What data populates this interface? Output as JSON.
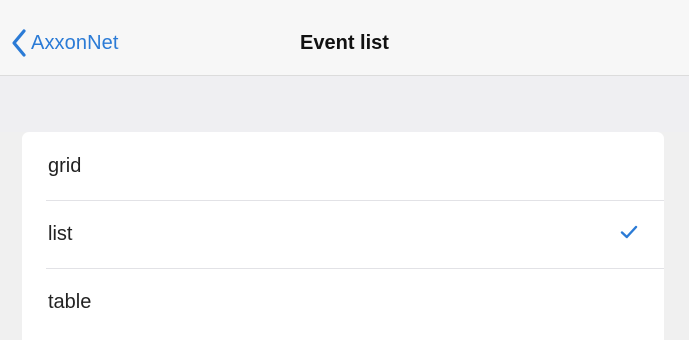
{
  "nav": {
    "back_label": "AxxonNet",
    "title": "Event list",
    "back_icon": "chevron-left-icon",
    "accent_color": "#2b7bd6"
  },
  "options": [
    {
      "label": "grid",
      "selected": false
    },
    {
      "label": "list",
      "selected": true
    },
    {
      "label": "table",
      "selected": false
    }
  ],
  "check_icon": "checkmark-icon"
}
